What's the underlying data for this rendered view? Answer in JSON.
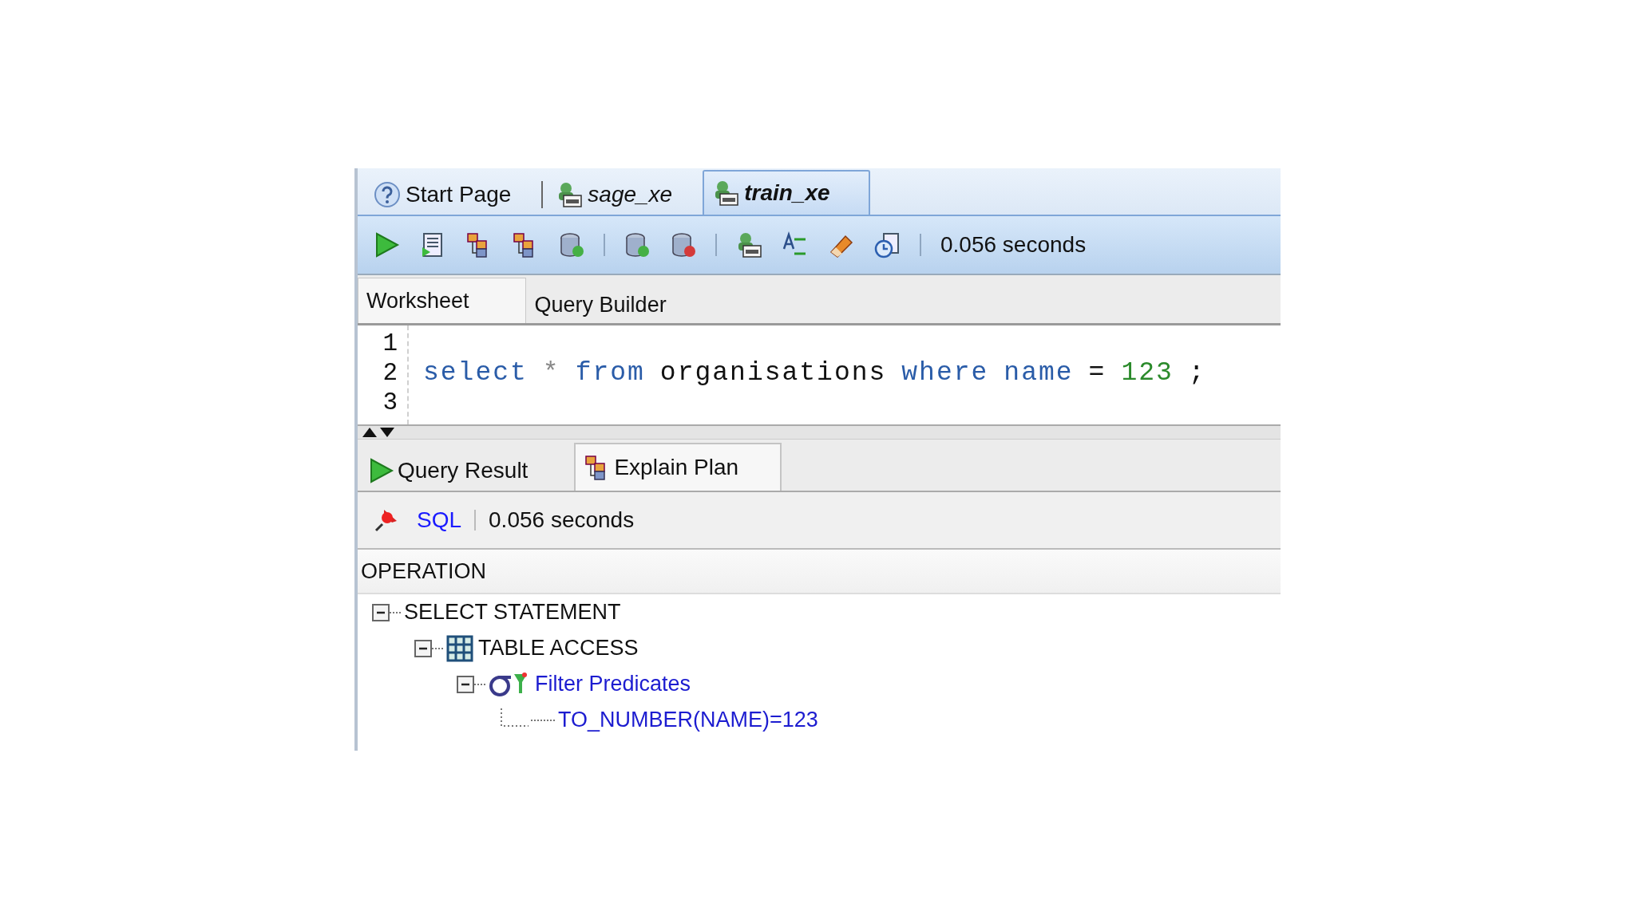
{
  "document_tabs": [
    {
      "label": "Start Page",
      "kind": "help",
      "selected": false
    },
    {
      "label": "sage_xe",
      "kind": "sql",
      "selected": false
    },
    {
      "label": "train_xe",
      "kind": "sql",
      "selected": true
    }
  ],
  "toolbar": {
    "elapsed": "0.056 seconds"
  },
  "editor_tabs": [
    {
      "label": "Worksheet",
      "selected": true
    },
    {
      "label": "Query Builder",
      "selected": false
    }
  ],
  "editor": {
    "lines": [
      {
        "number": "1"
      },
      {
        "number": "2",
        "tokens": [
          {
            "text": "select",
            "kind": "keyword"
          },
          {
            "text": "*",
            "kind": "operator"
          },
          {
            "text": "from",
            "kind": "keyword"
          },
          {
            "text": "organisations",
            "kind": "plain"
          },
          {
            "text": "where",
            "kind": "keyword"
          },
          {
            "text": "name",
            "kind": "keyword"
          },
          {
            "text": "=",
            "kind": "plain"
          },
          {
            "text": "123",
            "kind": "number"
          },
          {
            "text": ";",
            "kind": "plain"
          }
        ]
      },
      {
        "number": "3"
      }
    ]
  },
  "result_tabs": [
    {
      "label": "Query Result",
      "kind": "run",
      "selected": false
    },
    {
      "label": "Explain Plan",
      "kind": "plan",
      "selected": true
    }
  ],
  "result_toolbar": {
    "link": "SQL",
    "elapsed": "0.056 seconds"
  },
  "plan": {
    "column": "OPERATION",
    "tree": [
      {
        "label": "SELECT STATEMENT",
        "expanded": true,
        "children": [
          {
            "label": "TABLE ACCESS",
            "kind": "table",
            "expanded": true,
            "children": [
              {
                "label": "Filter Predicates",
                "kind": "filter",
                "expanded": true,
                "children": [
                  {
                    "label": "TO_NUMBER(NAME)=123",
                    "kind": "predicate"
                  }
                ]
              }
            ]
          }
        ]
      }
    ]
  }
}
